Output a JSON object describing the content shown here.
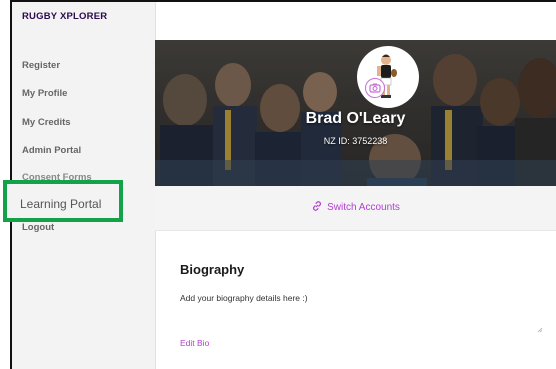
{
  "app": {
    "logo_text": "RUGBY XPLORER"
  },
  "sidebar": {
    "items": [
      {
        "label": "Register"
      },
      {
        "label": "My Profile"
      },
      {
        "label": "My Credits"
      },
      {
        "label": "Admin Portal"
      },
      {
        "label": "Consent Forms"
      },
      {
        "label": "Learning Portal"
      },
      {
        "label": "Logout"
      }
    ],
    "highlighted_item_index": 5,
    "highlight_color": "#13a24a"
  },
  "profile": {
    "name": "Brad O'Leary",
    "id_text": "NZ ID: 3752238",
    "avatar_icon": "rugby-player-icon",
    "camera_icon": "camera-icon"
  },
  "accounts": {
    "switch_label": "Switch Accounts",
    "switch_icon": "link-icon"
  },
  "biography": {
    "title": "Biography",
    "text": "Add your biography details here :)",
    "edit_label": "Edit Bio"
  },
  "colors": {
    "accent": "#b23fd1",
    "sidebar_bg": "#f3f3f3",
    "banner_dark": "#3d3a37"
  }
}
